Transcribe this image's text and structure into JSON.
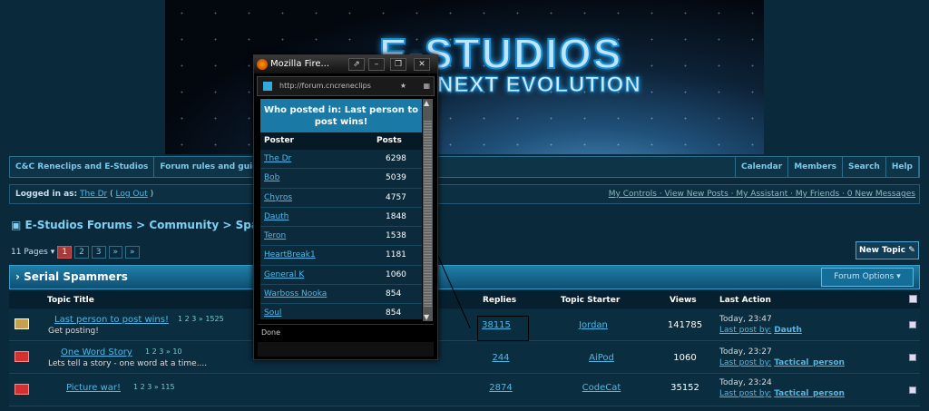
{
  "banner": {
    "logo_line1": "E-STUDIOS",
    "logo_line2": "NEXT EVOLUTION"
  },
  "nav": {
    "left": [
      "C&C Reneclips and E-Studios",
      "Forum rules and guid"
    ],
    "right": [
      "Calendar",
      "Members",
      "Search",
      "Help"
    ]
  },
  "userbar": {
    "logged_in_as": "Logged in as:",
    "user": "The Dr",
    "logout": "Log Out",
    "links": "My Controls · View New Posts · My Assistant · My Friends · 0 New Messages"
  },
  "breadcrumb": "E-Studios Forums > Community > Spammy Yu",
  "pagination": {
    "label": "11 Pages",
    "pages": [
      "1",
      "2",
      "3",
      "»",
      "»"
    ]
  },
  "new_topic": "New Topic",
  "category": {
    "title": "Serial Spammers",
    "options": "Forum Options"
  },
  "table": {
    "headers": {
      "title": "Topic Title",
      "replies": "Replies",
      "starter": "Topic Starter",
      "views": "Views",
      "action": "Last Action"
    },
    "rows": [
      {
        "title": "Last person to post wins!",
        "pages": "1  2  3  » 1525",
        "desc": "Get posting!",
        "replies": "38115",
        "starter": "Jordan",
        "views": "141785",
        "time": "Today, 23:47",
        "last": "Dauth"
      },
      {
        "title": "One Word Story",
        "pages": "1  2  3  » 10",
        "desc": "Lets tell a story - one word at a time....",
        "replies": "244",
        "starter": "AiPod",
        "views": "1060",
        "time": "Today, 23:27",
        "last": "Tactical_person"
      },
      {
        "title": "Picture war!",
        "pages": "1  2  3  » 115",
        "desc": "",
        "replies": "2874",
        "starter": "CodeCat",
        "views": "35152",
        "time": "Today, 23:24",
        "last": "Tactical_person"
      }
    ],
    "last_post_label": "Last post by:"
  },
  "popup": {
    "window_title": "Mozilla Fire...",
    "url": "http://forum.cncreneclips",
    "heading": "Who posted in: Last person to post wins!",
    "col_poster": "Poster",
    "col_posts": "Posts",
    "status": "Done",
    "posters": [
      {
        "name": "The Dr",
        "posts": "6298"
      },
      {
        "name": "Bob",
        "posts": "5039"
      },
      {
        "name": "Chyros",
        "posts": "4757"
      },
      {
        "name": "Dauth",
        "posts": "1848"
      },
      {
        "name": "Teron",
        "posts": "1538"
      },
      {
        "name": "HeartBreak1",
        "posts": "1181"
      },
      {
        "name": "General K",
        "posts": "1060"
      },
      {
        "name": "Warboss Nooka",
        "posts": "854"
      },
      {
        "name": "Soul",
        "posts": "854"
      }
    ]
  }
}
